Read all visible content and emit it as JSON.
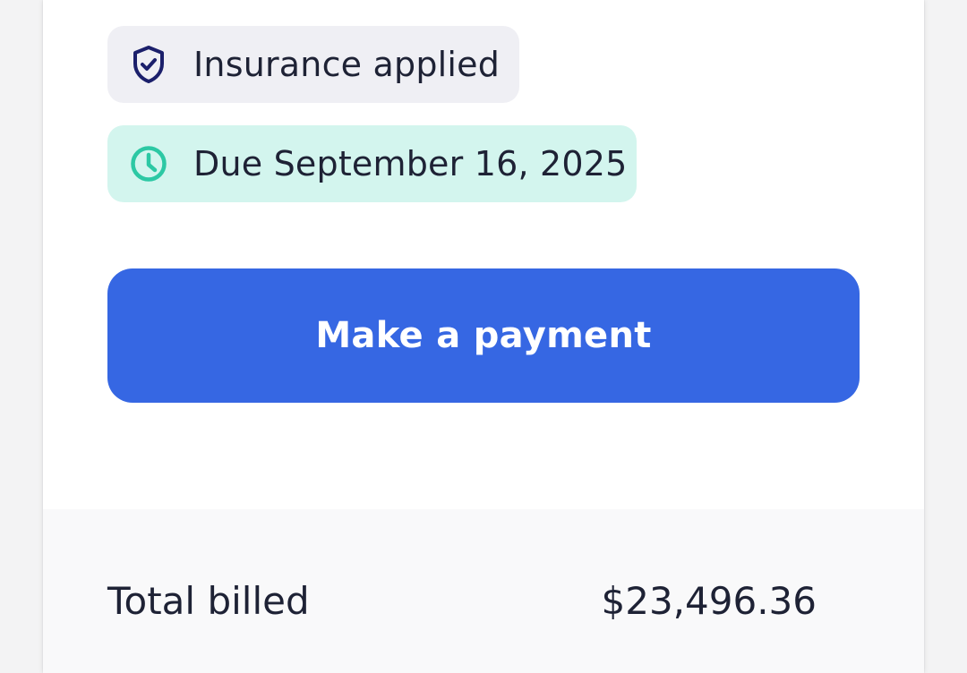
{
  "badges": {
    "insurance": {
      "label": "Insurance applied",
      "icon": "shield-check-icon",
      "background": "#efeff4",
      "icon_color": "#1b1f6b"
    },
    "due": {
      "label": "Due September 16, 2025",
      "icon": "clock-icon",
      "background": "#d3f5ee",
      "icon_color": "#2cc8a4"
    }
  },
  "actions": {
    "make_payment_label": "Make a payment",
    "button_color": "#3667e3"
  },
  "summary": {
    "total_billed_label": "Total billed",
    "total_billed_value": "$23,496.36"
  }
}
